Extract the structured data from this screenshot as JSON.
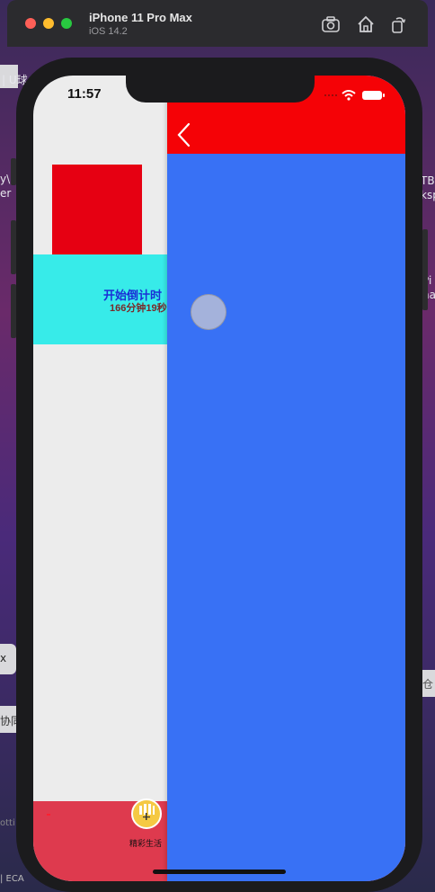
{
  "simulator": {
    "device_name": "iPhone 11 Pro Max",
    "os_version": "iOS 14.2",
    "toolbar_icons": [
      "screenshot-icon",
      "home-icon",
      "rotate-icon"
    ]
  },
  "desktop_fragments": {
    "left": [
      "| U球",
      "y\\",
      "er",
      "x",
      "协同",
      "otti",
      "| ECA"
    ],
    "right": [
      "TB",
      "ksp",
      "Pi",
      "na",
      "仓"
    ]
  },
  "status_bar": {
    "time": "11:57"
  },
  "back_page": {
    "countdown_title": "开始倒计时",
    "countdown_value": "166分钟19秒",
    "tab_label": "精彩生活"
  },
  "pushed_page": {
    "back_icon": "chevron-left-icon"
  },
  "colors": {
    "red_square": "#e60012",
    "cyan_block": "#37ebe9",
    "nav_red": "#f50206",
    "pushed_blue": "#3871f5",
    "tabbar_red": "#de3a4e"
  }
}
